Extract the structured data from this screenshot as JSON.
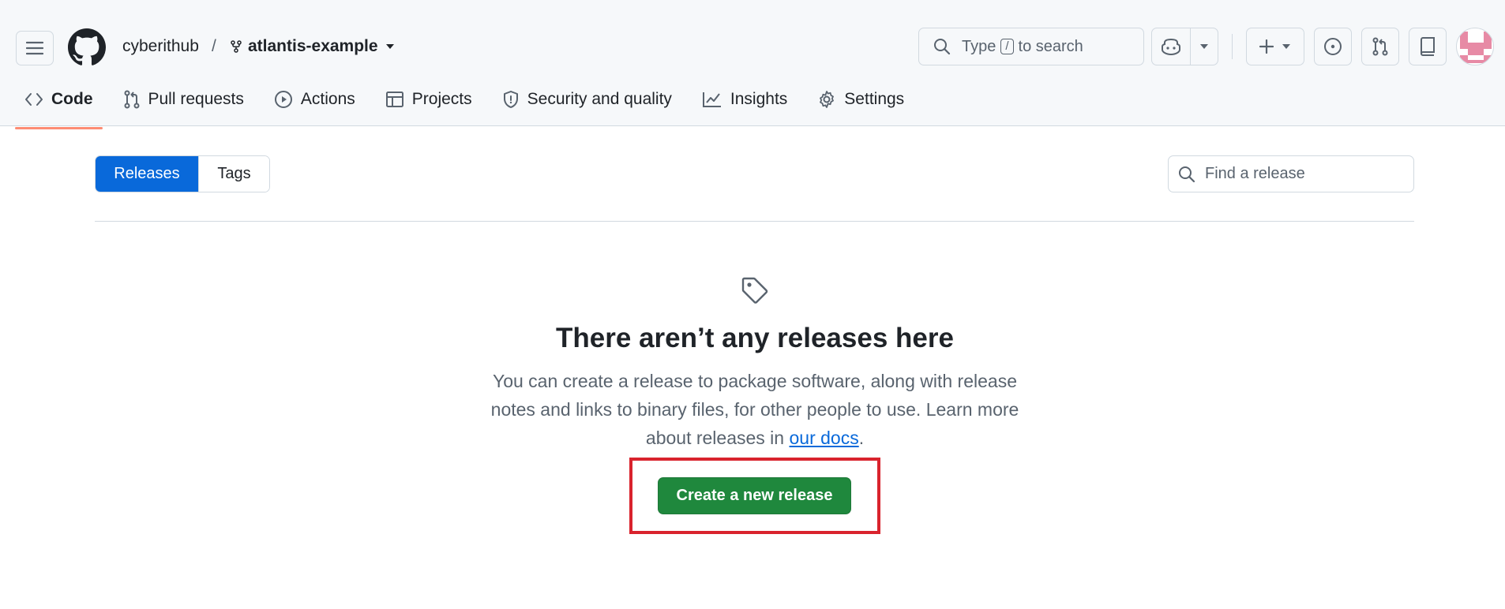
{
  "header": {
    "owner": "cyberithub",
    "separator": "/",
    "repo": "atlantis-example",
    "search_prefix": "Type",
    "search_key": "/",
    "search_suffix": "to search"
  },
  "tabs": [
    {
      "label": "Code",
      "icon": "code-icon",
      "active": true
    },
    {
      "label": "Pull requests",
      "icon": "git-pull-request-icon"
    },
    {
      "label": "Actions",
      "icon": "play-icon"
    },
    {
      "label": "Projects",
      "icon": "table-icon"
    },
    {
      "label": "Security and quality",
      "icon": "shield-icon"
    },
    {
      "label": "Insights",
      "icon": "graph-icon"
    },
    {
      "label": "Settings",
      "icon": "gear-icon"
    }
  ],
  "releases": {
    "toggle_releases": "Releases",
    "toggle_tags": "Tags",
    "find_placeholder": "Find a release"
  },
  "blankslate": {
    "title": "There aren’t any releases here",
    "desc_before": "You can create a release to package software, along with release notes and links to binary files, for other people to use. Learn more about releases in ",
    "link": "our docs",
    "desc_after": ".",
    "button": "Create a new release"
  },
  "colors": {
    "primary_button": "#1f883d",
    "accent_blue": "#0969da",
    "highlight_box": "#d9232d",
    "tab_underline": "#fd8c73"
  }
}
